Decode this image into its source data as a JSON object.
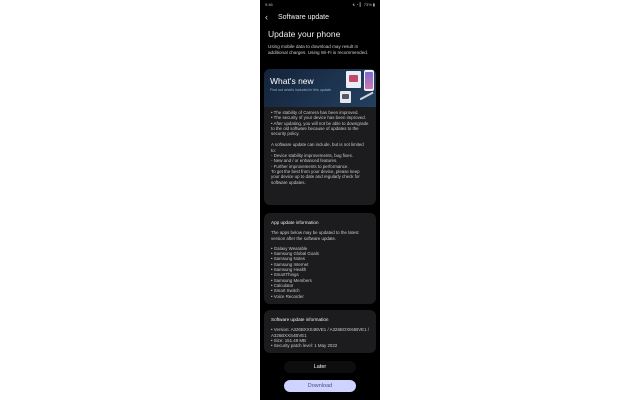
{
  "status_bar": {
    "time": "9:46",
    "battery": "73%"
  },
  "header": {
    "title": "Software update"
  },
  "page": {
    "title": "Update your phone",
    "warning": "Using mobile data to download may result in additional charges. Using Wi-Fi is recommended."
  },
  "whats_new": {
    "title": "What's new",
    "subtitle": "Find out what's included in this update.",
    "items": [
      "• The stability of Camera has been improved.",
      "• The security of your device has been improved.",
      "• After updating, you will not be able to downgrade to the old software because of updates to the security policy."
    ],
    "note_intro": "A software update can include, but is not limited to:",
    "note_items": [
      "- Device stability improvements, bug fixes.",
      "- New and / or enhanced features.",
      "- Further improvements to performance."
    ],
    "note_outro": "To get the best from your device, please keep your device up to date and regularly check for software updates."
  },
  "app_update": {
    "title": "App update information",
    "description": "The apps below may be updated to the latest version after the software update.",
    "apps": [
      "• Galaxy Wearable",
      "• Samsung Global Goals",
      "• Samsung Notes",
      "• Samsung Internet",
      "• Samsung Health",
      "• SmartThings",
      "• Samsung Members",
      "• Calculator",
      "• Smart Switch",
      "• Voice Recorder"
    ]
  },
  "software_info": {
    "title": "Software update information",
    "lines": [
      "• Version: A326BXXS4BVE1 / A326BOXM4BVE1 / A326BXXS4BVE1",
      "• Size: 151.49 MB",
      "• Security patch level: 1 May 2022"
    ]
  },
  "buttons": {
    "later": "Later",
    "download": "Download"
  }
}
